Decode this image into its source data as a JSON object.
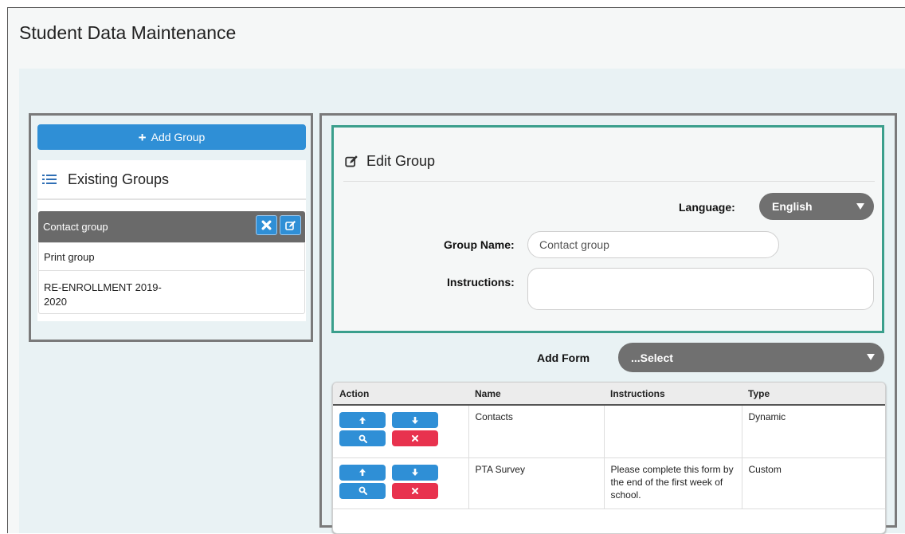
{
  "header": {
    "title": "Student Data Maintenance"
  },
  "left_panel": {
    "add_group_label": "Add Group",
    "existing_groups_title": "Existing Groups",
    "groups": [
      {
        "label": "Contact group",
        "selected": true
      },
      {
        "label": "Print group",
        "selected": false
      },
      {
        "label": "RE-ENROLLMENT 2019-\n2020",
        "selected": false
      }
    ]
  },
  "edit_group": {
    "title": "Edit Group",
    "language_label": "Language:",
    "language_value": "English",
    "group_name_label": "Group Name:",
    "group_name_value": "Contact group",
    "instructions_label": "Instructions:",
    "instructions_value": ""
  },
  "add_form": {
    "label": "Add Form",
    "select_value": "...Select"
  },
  "forms_table": {
    "columns": [
      "Action",
      "Name",
      "Instructions",
      "Type"
    ],
    "rows": [
      {
        "name": "Contacts",
        "instructions": "",
        "type": "Dynamic"
      },
      {
        "name": "PTA Survey",
        "instructions": "Please complete this form by the end of the first week of school.",
        "type": "Custom"
      }
    ]
  },
  "colors": {
    "primary_blue": "#2f8fd6",
    "danger_red": "#e8324e",
    "edit_border_teal": "#3a9f8c",
    "select_gray": "#707070",
    "panel_bg": "#e9f2f4"
  },
  "icons": {
    "add": "plus-icon",
    "list": "list-icon",
    "edit": "edit-icon",
    "delete": "x-icon",
    "move_up": "arrow-up-icon",
    "move_down": "arrow-down-icon",
    "view": "magnifier-icon",
    "dropdown": "caret-down-icon"
  }
}
